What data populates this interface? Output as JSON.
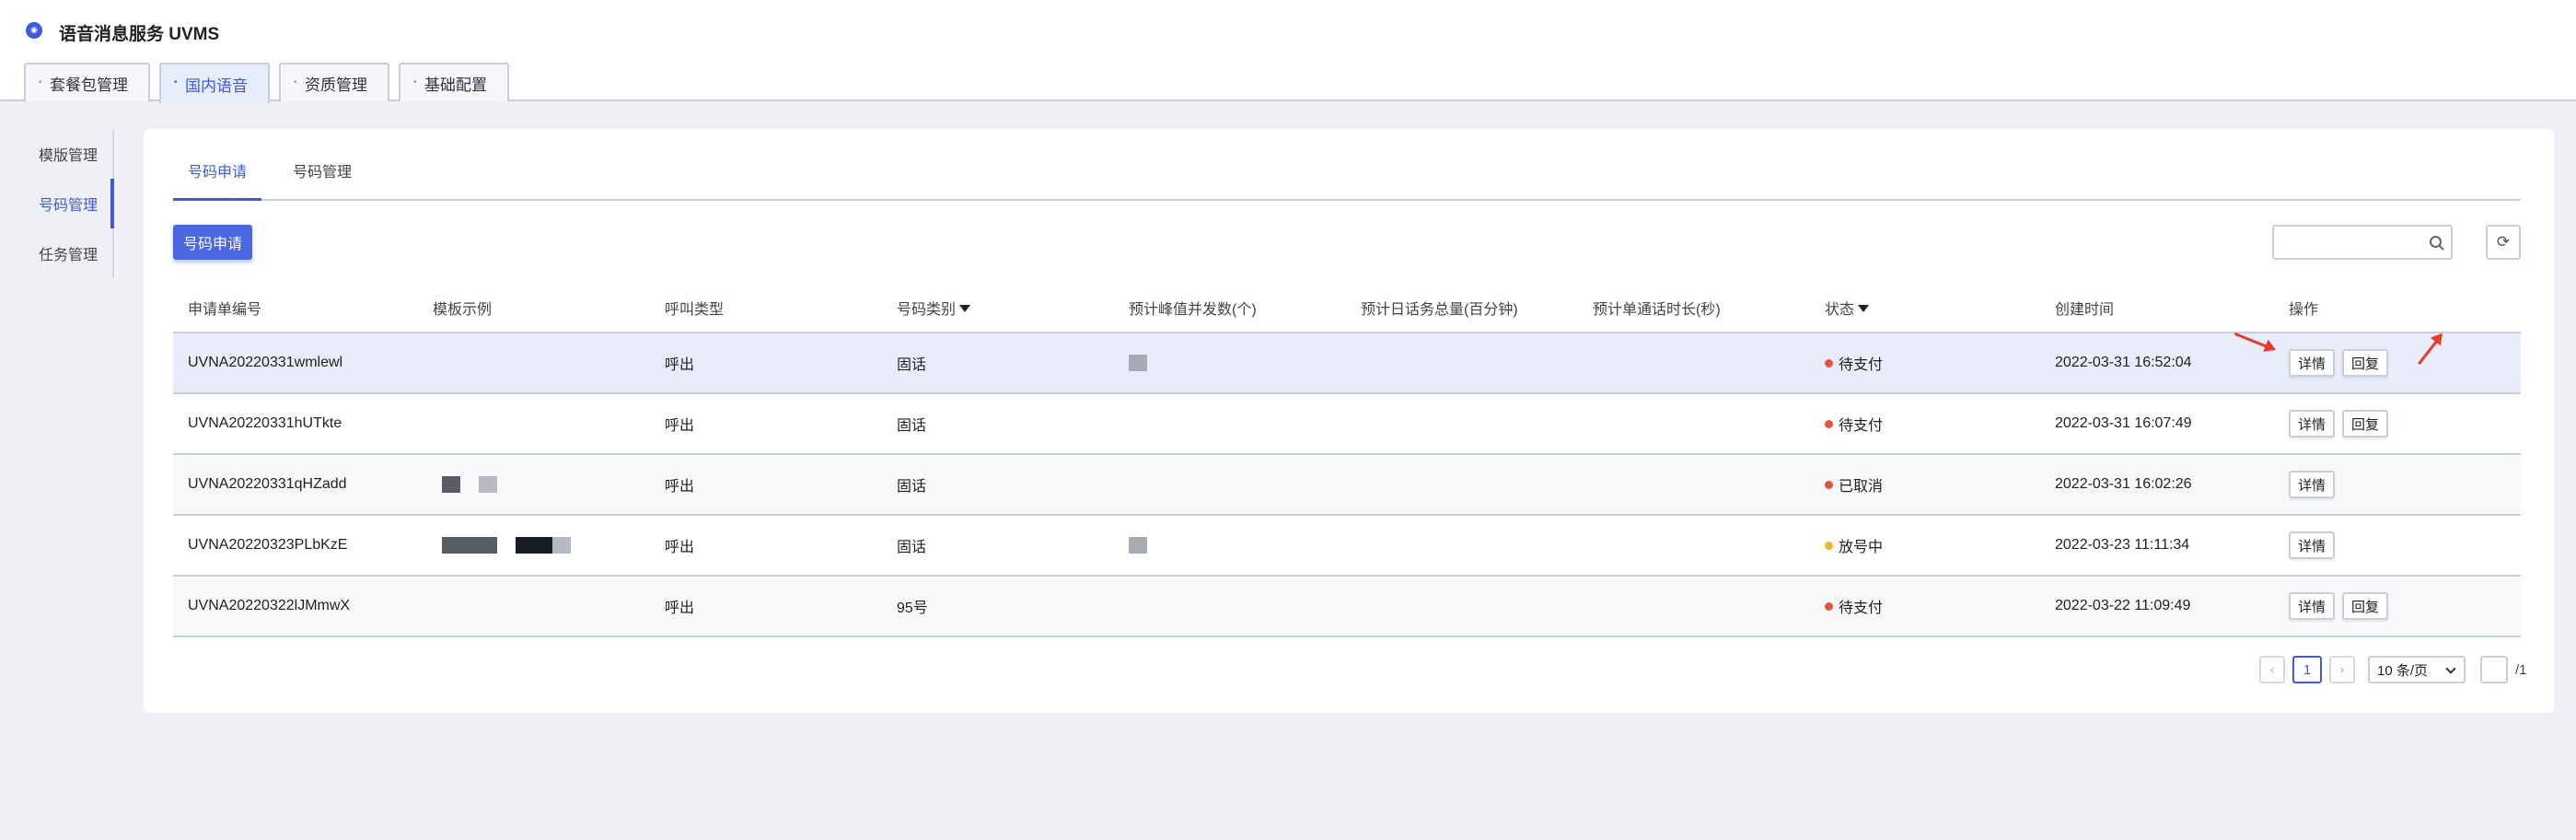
{
  "app": {
    "icon": "voice-logo-icon",
    "title": "语音消息服务 UVMS"
  },
  "top_tabs": [
    {
      "label": "套餐包管理"
    },
    {
      "label": "国内语音"
    },
    {
      "label": "资质管理"
    },
    {
      "label": "基础配置"
    }
  ],
  "sidebar": {
    "items": [
      {
        "label": "模版管理"
      },
      {
        "label": "号码管理"
      },
      {
        "label": "任务管理"
      }
    ]
  },
  "sub_tabs": [
    {
      "label": "号码申请"
    },
    {
      "label": "号码管理"
    }
  ],
  "toolbar": {
    "apply_label": "号码申请",
    "search_placeholder": "",
    "refresh_icon": "refresh-icon"
  },
  "table": {
    "headers": [
      "申请单编号",
      "模板示例",
      "呼叫类型",
      "号码类别",
      "预计峰值并发数(个)",
      "预计日话务总量(百分钟)",
      "预计单通话时长(秒)",
      "状态",
      "创建时间",
      "操作"
    ],
    "rows": [
      {
        "id": "UVNA20220331wmlewl",
        "call_type": "呼出",
        "number_type": "固话",
        "status": "待支付",
        "status_color": "#e5533d",
        "created": "2022-03-31 16:52:04",
        "detail": "详情",
        "reply": "回复"
      },
      {
        "id": "UVNA20220331hUTkte",
        "call_type": "呼出",
        "number_type": "固话",
        "status": "待支付",
        "status_color": "#e5533d",
        "created": "2022-03-31 16:07:49",
        "detail": "详情",
        "reply": "回复"
      },
      {
        "id": "UVNA20220331qHZadd",
        "call_type": "呼出",
        "number_type": "固话",
        "status": "已取消",
        "status_color": "#e5533d",
        "created": "2022-03-31 16:02:26",
        "detail": "详情"
      },
      {
        "id": "UVNA20220323PLbKzE",
        "call_type": "呼出",
        "number_type": "固话",
        "status": "放号中",
        "status_color": "#f2b62c",
        "created": "2022-03-23 11:11:34",
        "detail": "详情"
      },
      {
        "id": "UVNA20220322lJMmwX",
        "call_type": "呼出",
        "number_type": "95号",
        "status": "待支付",
        "status_color": "#e5533d",
        "created": "2022-03-22 11:09:49",
        "detail": "详情",
        "reply": "回复"
      }
    ]
  },
  "pagination": {
    "prev_icon": "chevron-left-icon",
    "current_page": "1",
    "next_icon": "chevron-right-icon",
    "page_size": "10 条/页",
    "total": "/1"
  }
}
